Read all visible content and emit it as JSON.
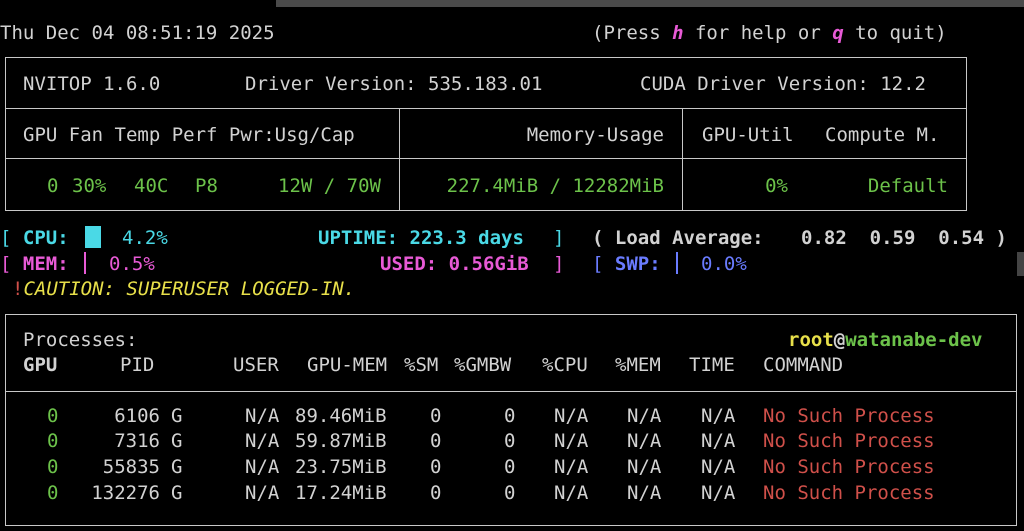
{
  "header": {
    "datetime": "Thu Dec 04 08:51:19 2025",
    "help_prefix": "(Press ",
    "help_key": "h",
    "help_mid": " for help or ",
    "quit_key": "q",
    "help_suffix": " to quit)"
  },
  "info": {
    "version": "NVITOP 1.6.0",
    "driver": "Driver Version: 535.183.01",
    "cuda": "CUDA Driver Version: 12.2"
  },
  "gpu_table": {
    "head_left": "GPU Fan Temp Perf Pwr:Usg/Cap",
    "head_mid": "Memory-Usage",
    "head_util": "GPU-Util",
    "head_compute": "Compute M.",
    "row": {
      "gpu": "0",
      "fan": "30%",
      "temp": "40C",
      "perf": "P8",
      "pwr": "12W / 70W",
      "memory": "227.4MiB / 12282MiB",
      "util": "0%",
      "compute": "Default"
    }
  },
  "stats": {
    "cpu_label": "CPU:",
    "cpu_value": "4.2%",
    "uptime": "UPTIME: 223.3 days",
    "load_label": "( Load Average:",
    "load_values": "0.82  0.59  0.54 )",
    "mem_label": "MEM:",
    "mem_value": "0.5%",
    "used": "USED: 0.56GiB",
    "swp_label": "SWP:",
    "swp_value": "0.0%",
    "caution_mark": "!",
    "caution": "CAUTION: SUPERUSER LOGGED-IN."
  },
  "processes": {
    "title": "Processes:",
    "user": "root",
    "at": "@",
    "host": "watanabe-dev",
    "columns": [
      "GPU",
      "PID",
      "USER",
      "GPU-MEM",
      "%SM",
      "%GMBW",
      "%CPU",
      "%MEM",
      "TIME",
      "COMMAND"
    ],
    "rows": [
      {
        "gpu": "0",
        "pid": "6106",
        "type": "G",
        "user": "N/A",
        "gpumem": "89.46MiB",
        "sm": "0",
        "gmbw": "0",
        "cpu": "N/A",
        "mem": "N/A",
        "time": "N/A",
        "command": "No Such Process"
      },
      {
        "gpu": "0",
        "pid": "7316",
        "type": "G",
        "user": "N/A",
        "gpumem": "59.87MiB",
        "sm": "0",
        "gmbw": "0",
        "cpu": "N/A",
        "mem": "N/A",
        "time": "N/A",
        "command": "No Such Process"
      },
      {
        "gpu": "0",
        "pid": "55835",
        "type": "G",
        "user": "N/A",
        "gpumem": "23.75MiB",
        "sm": "0",
        "gmbw": "0",
        "cpu": "N/A",
        "mem": "N/A",
        "time": "N/A",
        "command": "No Such Process"
      },
      {
        "gpu": "0",
        "pid": "132276",
        "type": "G",
        "user": "N/A",
        "gpumem": "17.24MiB",
        "sm": "0",
        "gmbw": "0",
        "cpu": "N/A",
        "mem": "N/A",
        "time": "N/A",
        "command": "No Such Process"
      }
    ]
  },
  "colors": {
    "green": "#6cc24a",
    "cyan": "#4ad9e6",
    "magenta": "#e85ad6",
    "blue": "#6a7cff",
    "red": "#d0504a",
    "yellow": "#e8e04a"
  }
}
